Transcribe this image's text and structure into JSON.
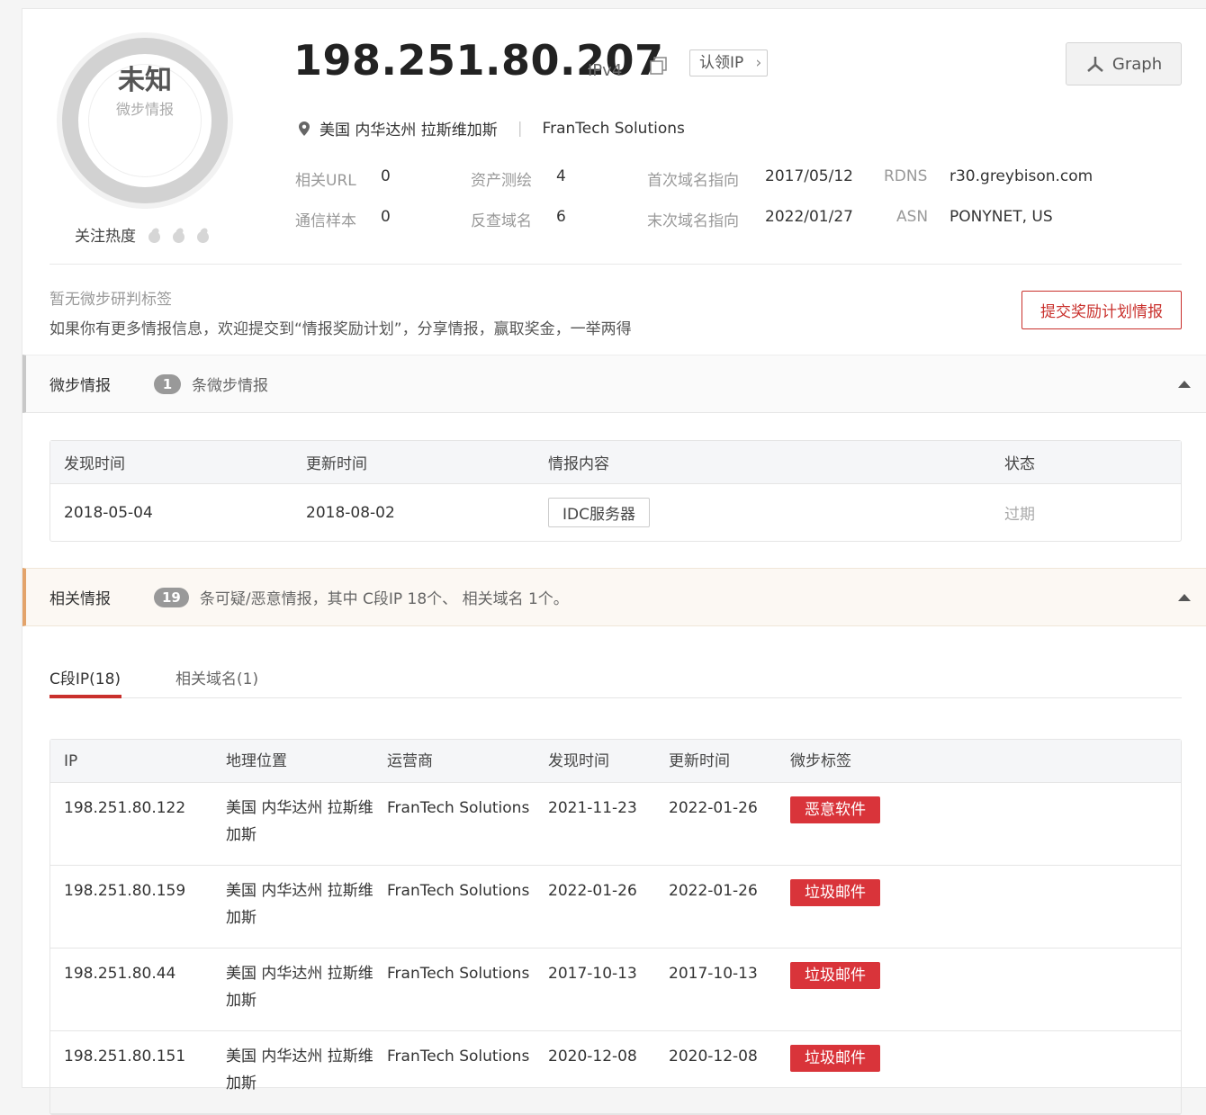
{
  "header": {
    "verdict": "未知",
    "verdict_source": "微步情报",
    "heat_label": "关注热度",
    "ip": "198.251.80.207",
    "ip_version": "IPv4",
    "claim_label": "认领IP",
    "graph_label": "Graph",
    "location": "美国 内华达州 拉斯维加斯",
    "isp": "FranTech Solutions"
  },
  "meta": {
    "related_url_label": "相关URL",
    "related_url_value": "0",
    "asset_label": "资产测绘",
    "asset_value": "4",
    "first_label": "首次域名指向",
    "first_value": "2017/05/12",
    "rdns_label": "RDNS",
    "rdns_value": "r30.greybison.com",
    "comm_label": "通信样本",
    "comm_value": "0",
    "reverse_label": "反查域名",
    "reverse_value": "6",
    "last_label": "末次域名指向",
    "last_value": "2022/01/27",
    "asn_label": "ASN",
    "asn_value": "PONYNET, US"
  },
  "tags": {
    "none": "暂无微步研判标签",
    "desc": "如果你有更多情报信息，欢迎提交到“情报奖励计划”，分享情报，赢取奖金，一举两得",
    "submit": "提交奖励计划情报"
  },
  "intel": {
    "title": "微步情报",
    "count": "1",
    "desc": "条微步情报",
    "headers": [
      "发现时间",
      "更新时间",
      "情报内容",
      "状态"
    ],
    "row": {
      "found": "2018-05-04",
      "updated": "2018-08-02",
      "content": "IDC服务器",
      "status": "过期"
    }
  },
  "related": {
    "title": "相关情报",
    "count": "19",
    "desc": "条可疑/恶意情报，其中 C段IP 18个、 相关域名 1个。",
    "tabs": [
      "C段IP(18)",
      "相关域名(1)"
    ],
    "headers": [
      "IP",
      "地理位置",
      "运营商",
      "发现时间",
      "更新时间",
      "微步标签"
    ],
    "rows": [
      {
        "ip": "198.251.80.122",
        "geo": "美国 内华达州 拉斯维加斯",
        "isp": "FranTech Solutions",
        "found": "2021-11-23",
        "updated": "2022-01-26",
        "tag": "恶意软件"
      },
      {
        "ip": "198.251.80.159",
        "geo": "美国 内华达州 拉斯维加斯",
        "isp": "FranTech Solutions",
        "found": "2022-01-26",
        "updated": "2022-01-26",
        "tag": "垃圾邮件"
      },
      {
        "ip": "198.251.80.44",
        "geo": "美国 内华达州 拉斯维加斯",
        "isp": "FranTech Solutions",
        "found": "2017-10-13",
        "updated": "2017-10-13",
        "tag": "垃圾邮件"
      },
      {
        "ip": "198.251.80.151",
        "geo": "美国 内华达州 拉斯维加斯",
        "isp": "FranTech Solutions",
        "found": "2020-12-08",
        "updated": "2020-12-08",
        "tag": "垃圾邮件"
      }
    ]
  }
}
